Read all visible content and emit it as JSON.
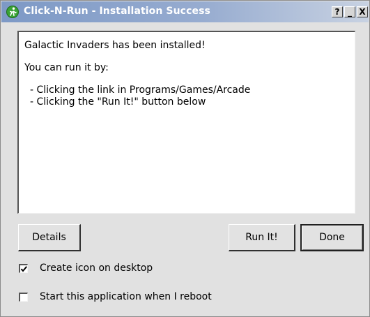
{
  "window": {
    "title": "Click-N-Run - Installation Success",
    "icon": "click-n-run-logo-icon",
    "controls": {
      "help": "?",
      "minimize": "_",
      "close": "X"
    }
  },
  "message": {
    "lines": [
      "Galactic Invaders has been installed!",
      "You can run it by:",
      "- Clicking the link in Programs/Games/Arcade",
      "- Clicking the \"Run It!\" button below"
    ]
  },
  "buttons": {
    "details": "Details",
    "run_it": "Run It!",
    "done": "Done"
  },
  "options": {
    "create_icon": {
      "label": "Create icon on desktop",
      "checked": true
    },
    "start_on_reboot": {
      "label": "Start this application when I reboot",
      "checked": false
    }
  },
  "colors": {
    "titlebar_start": "#7d99c6",
    "titlebar_end": "#c8d2e2",
    "logo_green": "#3aa335",
    "window_bg": "#e1e1e1"
  }
}
